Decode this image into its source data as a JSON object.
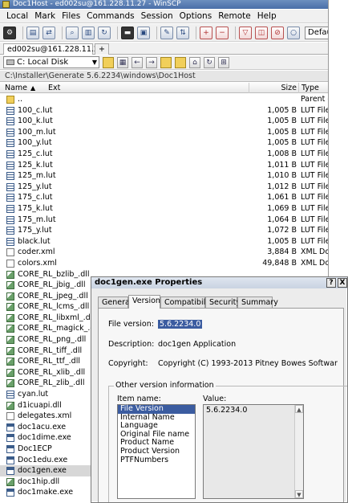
{
  "window": {
    "title": "Doc1Host - ed002su@161.228.11.27 - WinSCP"
  },
  "menu": [
    "Local",
    "Mark",
    "Files",
    "Commands",
    "Session",
    "Options",
    "Remote",
    "Help"
  ],
  "toolbar": {
    "session_preset": "Default"
  },
  "tabs": {
    "session_tab": "ed002su@161.228.11.27",
    "new_tab": "+"
  },
  "pathbar": {
    "drive": "C: Local Disk"
  },
  "address": "C:\\Installer\\Generate 5.6.2234\\windows\\Doc1Host",
  "columns": {
    "name": "Name",
    "ext": "Ext",
    "size": "Size",
    "type": "Type"
  },
  "files": [
    {
      "name": "..",
      "size": "",
      "type": "Parent d",
      "icon": "parent"
    },
    {
      "name": "100_c.lut",
      "size": "1,005 B",
      "type": "LUT File",
      "icon": "lut"
    },
    {
      "name": "100_k.lut",
      "size": "1,005 B",
      "type": "LUT File",
      "icon": "lut"
    },
    {
      "name": "100_m.lut",
      "size": "1,005 B",
      "type": "LUT File",
      "icon": "lut"
    },
    {
      "name": "100_y.lut",
      "size": "1,005 B",
      "type": "LUT File",
      "icon": "lut"
    },
    {
      "name": "125_c.lut",
      "size": "1,008 B",
      "type": "LUT File",
      "icon": "lut"
    },
    {
      "name": "125_k.lut",
      "size": "1,011 B",
      "type": "LUT File",
      "icon": "lut"
    },
    {
      "name": "125_m.lut",
      "size": "1,010 B",
      "type": "LUT File",
      "icon": "lut"
    },
    {
      "name": "125_y.lut",
      "size": "1,012 B",
      "type": "LUT File",
      "icon": "lut"
    },
    {
      "name": "175_c.lut",
      "size": "1,061 B",
      "type": "LUT File",
      "icon": "lut"
    },
    {
      "name": "175_k.lut",
      "size": "1,069 B",
      "type": "LUT File",
      "icon": "lut"
    },
    {
      "name": "175_m.lut",
      "size": "1,064 B",
      "type": "LUT File",
      "icon": "lut"
    },
    {
      "name": "175_y.lut",
      "size": "1,072 B",
      "type": "LUT File",
      "icon": "lut"
    },
    {
      "name": "black.lut",
      "size": "1,005 B",
      "type": "LUT File",
      "icon": "lut"
    },
    {
      "name": "coder.xml",
      "size": "3,884 B",
      "type": "XML Doc",
      "icon": "xml"
    },
    {
      "name": "colors.xml",
      "size": "49,848 B",
      "type": "XML Doc",
      "icon": "xml"
    },
    {
      "name": "CORE_RL_bzlib_.dll",
      "size": "",
      "type": "",
      "icon": "dll"
    },
    {
      "name": "CORE_RL_jbig_.dll",
      "size": "",
      "type": "",
      "icon": "dll"
    },
    {
      "name": "CORE_RL_jpeg_.dll",
      "size": "",
      "type": "",
      "icon": "dll"
    },
    {
      "name": "CORE_RL_lcms_.dll",
      "size": "",
      "type": "",
      "icon": "dll"
    },
    {
      "name": "CORE_RL_libxml_.dll",
      "size": "",
      "type": "",
      "icon": "dll"
    },
    {
      "name": "CORE_RL_magick_.dll",
      "size": "",
      "type": "",
      "icon": "dll"
    },
    {
      "name": "CORE_RL_png_.dll",
      "size": "",
      "type": "",
      "icon": "dll"
    },
    {
      "name": "CORE_RL_tiff_.dll",
      "size": "",
      "type": "",
      "icon": "dll"
    },
    {
      "name": "CORE_RL_ttf_.dll",
      "size": "",
      "type": "",
      "icon": "dll"
    },
    {
      "name": "CORE_RL_xlib_.dll",
      "size": "",
      "type": "",
      "icon": "dll"
    },
    {
      "name": "CORE_RL_zlib_.dll",
      "size": "",
      "type": "",
      "icon": "dll"
    },
    {
      "name": "cyan.lut",
      "size": "",
      "type": "",
      "icon": "lut"
    },
    {
      "name": "d1icuapi.dll",
      "size": "",
      "type": "",
      "icon": "dll"
    },
    {
      "name": "delegates.xml",
      "size": "",
      "type": "",
      "icon": "xml"
    },
    {
      "name": "doc1acu.exe",
      "size": "",
      "type": "",
      "icon": "exe"
    },
    {
      "name": "doc1dime.exe",
      "size": "",
      "type": "",
      "icon": "exe"
    },
    {
      "name": "Doc1ECP",
      "size": "",
      "type": "",
      "icon": "exe"
    },
    {
      "name": "Doc1edu.exe",
      "size": "",
      "type": "",
      "icon": "exe"
    },
    {
      "name": "doc1gen.exe",
      "size": "",
      "type": "",
      "icon": "exe",
      "selected": true
    },
    {
      "name": "doc1hip.dll",
      "size": "",
      "type": "",
      "icon": "dll"
    },
    {
      "name": "doc1make.exe",
      "size": "",
      "type": "",
      "icon": "exe"
    }
  ],
  "dialog": {
    "title": "doc1gen.exe Properties",
    "help": "?",
    "close": "X",
    "tabs": [
      "General",
      "Version",
      "Compatibility",
      "Security",
      "Summary"
    ],
    "file_version_label": "File version:",
    "file_version_value": "5.6.2234.0",
    "description_label": "Description:",
    "description_value": "doc1gen Application",
    "copyright_label": "Copyright:",
    "copyright_value": "Copyright (C) 1993-2013 Pitney Bowes Softwar",
    "group_title": "Other version information",
    "item_name_label": "Item name:",
    "value_label": "Value:",
    "items": [
      "File Version",
      "Internal Name",
      "Language",
      "Original File name",
      "Product Name",
      "Product Version",
      "PTFNumbers"
    ],
    "selected_value": "5.6.2234.0"
  },
  "colors": {
    "selection": "#3b5ca0",
    "titlebar": "#4a6ea8",
    "row_selected": "#d7d7d7"
  },
  "icons": {
    "toolbar": [
      "gear-icon",
      "queue-icon",
      "sync-icon",
      "find-icon",
      "refresh-icon",
      "terminal-icon",
      "preferences-icon",
      "compare-icon",
      "keep-up-to-date-icon",
      "plus-icon",
      "minus-icon",
      "filter-icon",
      "select-icon",
      "unselect-icon",
      "clear-icon"
    ],
    "path": [
      "folder-open-icon",
      "filter-icon",
      "back-icon",
      "forward-icon",
      "parent-dir-icon",
      "root-dir-icon",
      "home-icon",
      "refresh-icon",
      "tree-icon"
    ]
  }
}
